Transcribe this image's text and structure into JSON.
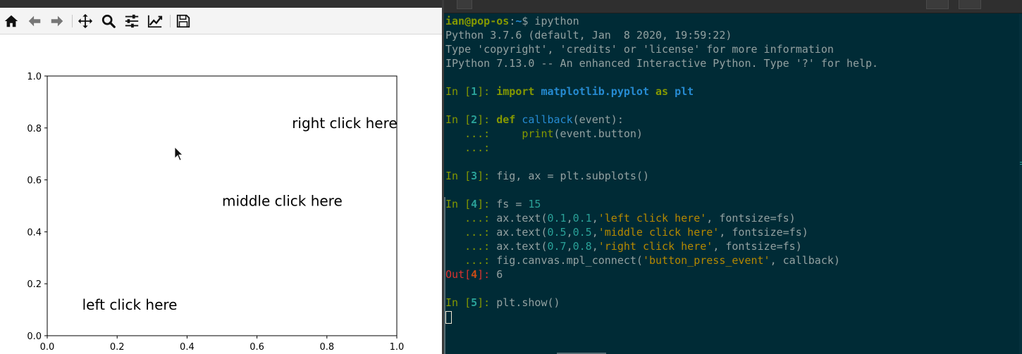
{
  "mpl": {
    "toolbar": {
      "home_icon": "home-icon",
      "back_icon": "arrow-left-icon",
      "forward_icon": "arrow-right-icon",
      "pan_icon": "move-icon",
      "zoom_icon": "magnifier-icon",
      "configure_icon": "sliders-icon",
      "axes_icon": "line-chart-icon",
      "save_icon": "floppy-disk-icon"
    },
    "chart_data": {
      "type": "scatter",
      "xlim": [
        0.0,
        1.0
      ],
      "ylim": [
        0.0,
        1.0
      ],
      "xticks": [
        "0.0",
        "0.2",
        "0.4",
        "0.6",
        "0.8",
        "1.0"
      ],
      "yticks": [
        "0.0",
        "0.2",
        "0.4",
        "0.6",
        "0.8",
        "1.0"
      ],
      "grid": false,
      "annotations": [
        {
          "x": 0.1,
          "y": 0.1,
          "text": "left click here"
        },
        {
          "x": 0.5,
          "y": 0.5,
          "text": "middle click here"
        },
        {
          "x": 0.7,
          "y": 0.8,
          "text": "right click here"
        }
      ]
    }
  },
  "terminal": {
    "prompt_user": "ian@pop-os",
    "prompt_sep": ":",
    "prompt_dir": "~",
    "prompt_dollar": "$",
    "prompt_cmd": " ipython",
    "banner_1": "Python 3.7.6 (default, Jan  8 2020, 19:59:22)",
    "banner_2": "Type 'copyright', 'credits' or 'license' for more information",
    "banner_3": "IPython 7.13.0 -- An enhanced Interactive Python. Type '?' for help.",
    "in_label": "In [",
    "out_label": "Out[",
    "close_bracket": "]: ",
    "cont": "   ...: ",
    "n1": "1",
    "n2": "2",
    "n3": "3",
    "n4": "4",
    "n5": "5",
    "kw_import": "import",
    "mod_name": "matplotlib.pyplot",
    "kw_as": "as",
    "alias": "plt",
    "kw_def": "def",
    "fn_name": "callback",
    "fn_args": "(event):",
    "indent": "    ",
    "fn_print": "print",
    "print_args": "(event.button)",
    "line3": "fig, ax = plt.subplots()",
    "fs_assign": "fs = ",
    "fs_val": "15",
    "text_call": "ax.text(",
    "comma": ",",
    "args_end": ", fontsize=fs)",
    "t1_x": "0.1",
    "t1_y": "0.1",
    "t1_str": "'left click here'",
    "t2_x": "0.5",
    "t2_y": "0.5",
    "t2_str": "'middle click here'",
    "t3_x": "0.7",
    "t3_y": "0.8",
    "t3_str": "'right click here'",
    "connect_pre": "fig.canvas.mpl_connect(",
    "connect_str": "'button_press_event'",
    "connect_post": ", callback)",
    "out4_val": "6",
    "line5": "plt.show()"
  }
}
